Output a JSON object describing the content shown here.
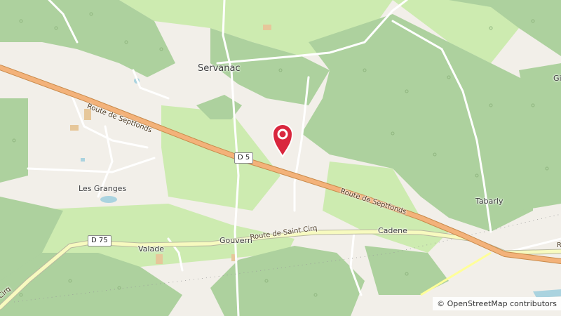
{
  "map": {
    "places": {
      "servanac": "Servanac",
      "les_granges": "Les Granges",
      "tabarly": "Tabarly",
      "cadene": "Cadene",
      "valade": "Valade",
      "gouvern": "Gouvern",
      "edge_gi": "Gi",
      "edge_cirq": "Cirq",
      "edge_r": "R"
    },
    "roads": {
      "septfonds_1": "Route de Septfonds",
      "septfonds_2": "Route de Septfonds",
      "saint_cirq": "Route de Saint Cirq",
      "d5_ref": "D 5",
      "d75_ref": "D 75"
    },
    "marker": {
      "type": "location-pin",
      "color": "#d9263d"
    },
    "colors": {
      "land": "#f2efe9",
      "forest": "#add19e",
      "meadow": "#cdebb0",
      "secondary_road": "#f7fabf",
      "primary_road": "#f3b27a",
      "road_casing": "#c88a4a",
      "minor_road": "#ffffff",
      "water": "#aad3df"
    }
  },
  "attribution": {
    "symbol": "©",
    "text": "OpenStreetMap contributors"
  }
}
